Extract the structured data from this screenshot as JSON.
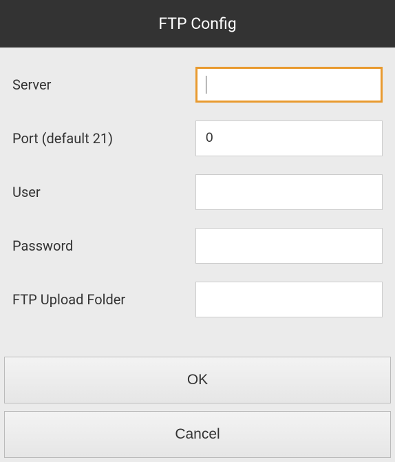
{
  "header": {
    "title": "FTP Config"
  },
  "form": {
    "server": {
      "label": "Server",
      "value": ""
    },
    "port": {
      "label": "Port (default 21)",
      "value": "0"
    },
    "user": {
      "label": "User",
      "value": ""
    },
    "password": {
      "label": "Password",
      "value": ""
    },
    "upload_folder": {
      "label": "FTP Upload Folder",
      "value": ""
    }
  },
  "buttons": {
    "ok": "OK",
    "cancel": "Cancel"
  }
}
